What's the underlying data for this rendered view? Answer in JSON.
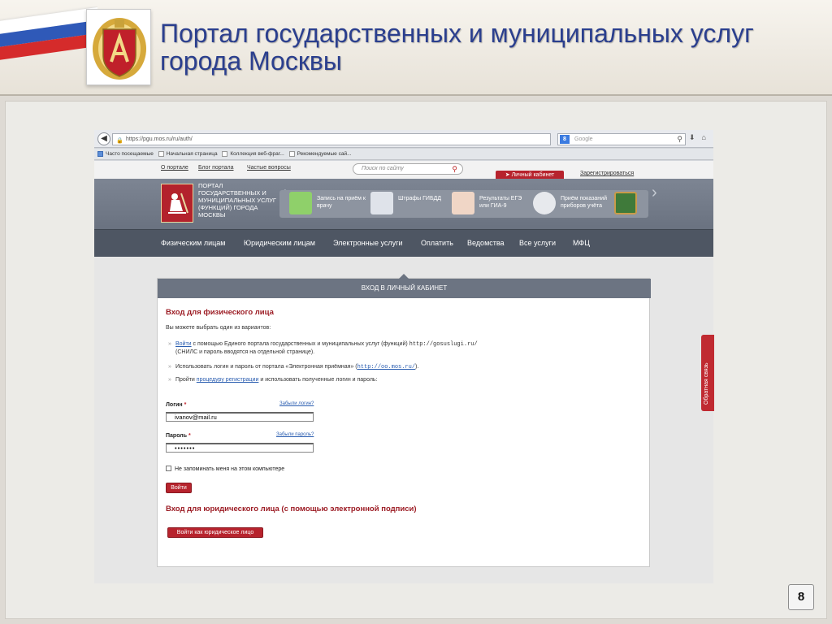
{
  "slide": {
    "title_line1": "Портал государственных и муниципальных услуг",
    "title_line2": "города Москвы",
    "page_number": "8",
    "flag_colors": [
      "#ffffff",
      "#2f59b8",
      "#d52b2b"
    ]
  },
  "browser": {
    "url": "https://pgu.mos.ru/ru/auth/",
    "search_placeholder": "Google",
    "bookmarks": [
      "Часто посещаемые",
      "Начальная страница",
      "Коллекция веб-фраг...",
      "Рекомендуемые сай..."
    ]
  },
  "site": {
    "top_links": [
      "О портале",
      "Блог портала",
      "Частые вопросы"
    ],
    "search_placeholder": "Поиск по сайту",
    "cabinet_button": "Личный кабинет",
    "register_link": "Зарегистрироваться",
    "site_name": "Портал государственных и муниципальных услуг (функций) города Москвы",
    "services": [
      {
        "label": "Запись на приём к врачу",
        "icon": "medical-cross-icon"
      },
      {
        "label": "Штрафы ГИБДД",
        "icon": "traffic-fine-icon"
      },
      {
        "label": "Результаты ЕГЭ или ГИА-9",
        "icon": "exam-results-icon"
      },
      {
        "label": "Приём показаний приборов учёта",
        "icon": "meter-icon"
      },
      {
        "label": "",
        "icon": "school-board-icon"
      }
    ],
    "menu": [
      "Физическим лицам",
      "Юридическим лицам",
      "Электронные услуги",
      "Оплатить",
      "Ведомства",
      "Все услуги",
      "МФЦ"
    ],
    "accent_red": "#b7232d"
  },
  "login": {
    "panel_title": "Вход в личный кабинет",
    "individual_heading": "Вход для физического лица",
    "intro": "Вы можете выбрать один из вариантов:",
    "option1_link": "Войти",
    "option1_text": " с помощью Единого портала государственных и муниципальных услуг (функций) ",
    "option1_url": "http://gosuslugi.ru/",
    "option1_line2": "(СНИЛС и пароль вводятся на отдельной странице).",
    "option2_text": "Использовать логин и пароль от портала «Электронная приёмная» (",
    "option2_url": "http://oo.mos.ru/",
    "option2_end": ").",
    "option3_text": "Пройти ",
    "option3_link": "процедуру регистрации",
    "option3_end": " и использовать полученные логин и пароль:",
    "login_label": "Логин",
    "forgot_login": "Забыли логин?",
    "login_value": "ivanov@mail.ru",
    "password_label": "Пароль",
    "forgot_password": "Забыли пароль?",
    "password_value": "•••••••",
    "remember_label": "Не запоминать меня на этом компьютере",
    "submit_button": "Войти",
    "legal_heading": "Вход для юридического лица (с помощью электронной подписи)",
    "legal_button": "Войти как юридическое лицо"
  },
  "feedback_tab": "Обратная связь"
}
